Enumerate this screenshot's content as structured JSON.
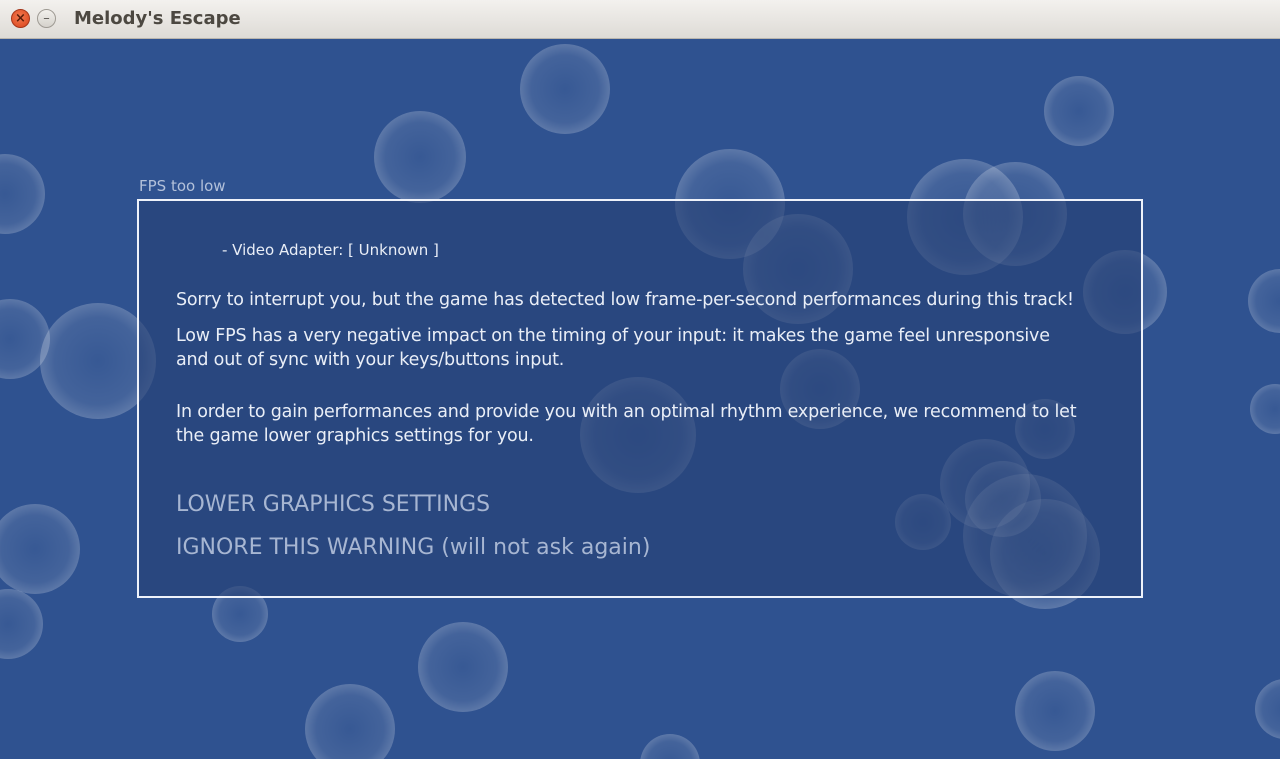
{
  "window": {
    "title": "Melody's Escape"
  },
  "section_label": "FPS too low",
  "dialog": {
    "adapter_line": "- Video Adapter: [ Unknown ]",
    "message_lines": [
      "Sorry to interrupt you, but the game has detected low frame-per-second performances during this track!",
      "Low FPS has a very negative impact on the timing of your input: it makes the game feel unresponsive",
      "and out of sync with your keys/buttons input.",
      "In order to gain performances and provide you with an optimal rhythm experience, we recommend to let",
      "the game lower graphics settings for you."
    ],
    "options": [
      "LOWER GRAPHICS SETTINGS",
      "IGNORE THIS WARNING (will not ask again)"
    ]
  },
  "colors": {
    "background": "#2f5290",
    "dialog_border": "#eef2fa",
    "text": "#e9eef7",
    "option_text": "#a7b6d2",
    "close_button": "#e2562b"
  },
  "icons": {
    "close": "close-icon",
    "minimize": "minimize-icon"
  }
}
